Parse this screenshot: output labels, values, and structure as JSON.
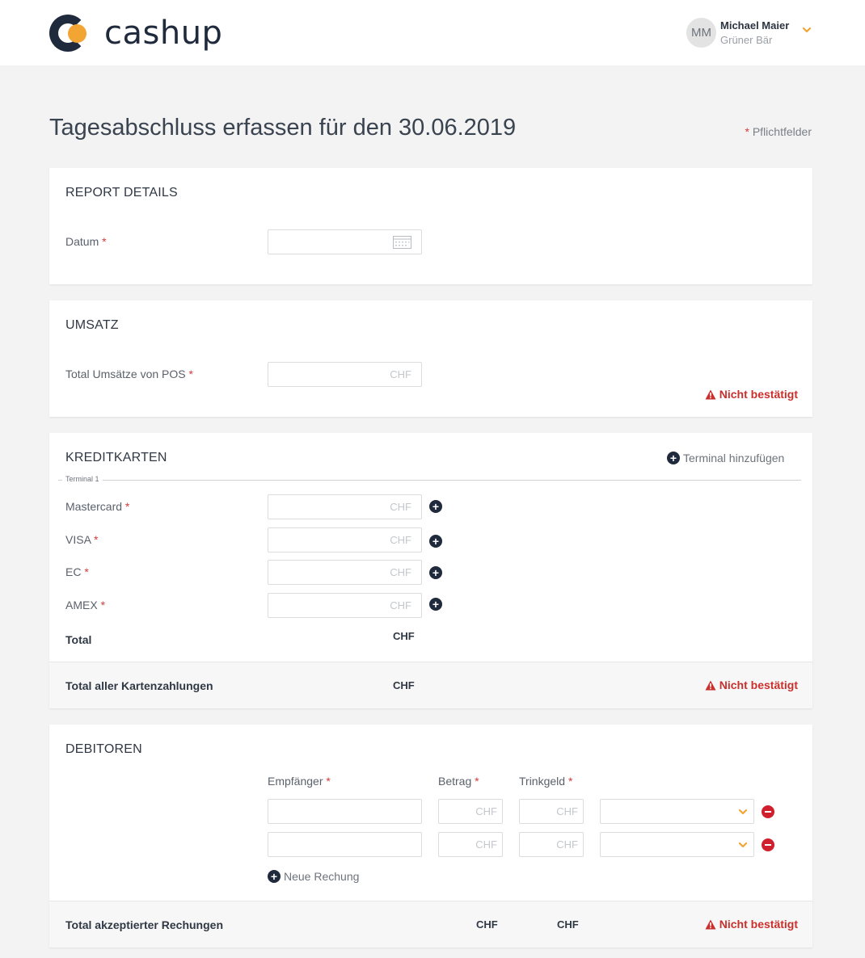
{
  "brand": {
    "name": "cashup",
    "accent": "#f3a533",
    "dark": "#1f2a3c",
    "danger": "#c9302c"
  },
  "user": {
    "initials": "MM",
    "name": "Michael Maier",
    "subtitle": "Grüner Bär"
  },
  "page": {
    "title": "Tagesabschluss erfassen für den 30.06.2019",
    "required_note": "Pflichtfelder",
    "required_mark": "*"
  },
  "report_details": {
    "title": "REPORT DETAILS",
    "date_label": "Datum"
  },
  "umsatz": {
    "title": "UMSATZ",
    "pos_label": "Total Umsätze von POS",
    "pos_placeholder": "CHF",
    "status": "Nicht bestätigt"
  },
  "kreditkarten": {
    "title": "KREDITKARTEN",
    "add_terminal": "Terminal hinzufügen",
    "terminal_label": "Terminal 1",
    "cards": [
      {
        "label": "Mastercard",
        "placeholder": "CHF"
      },
      {
        "label": "VISA",
        "placeholder": "CHF"
      },
      {
        "label": "EC",
        "placeholder": "CHF"
      },
      {
        "label": "AMEX",
        "placeholder": "CHF"
      }
    ],
    "total_label": "Total",
    "total_value": "CHF",
    "all_total_label": "Total aller Kartenzahlungen",
    "all_total_value": "CHF",
    "status": "Nicht bestätigt"
  },
  "debitoren": {
    "title": "DEBITOREN",
    "col_recipient": "Empfänger",
    "col_amount": "Betrag",
    "col_tip": "Trinkgeld",
    "rows": [
      {
        "amount_placeholder": "CHF",
        "tip_placeholder": "CHF"
      },
      {
        "amount_placeholder": "CHF",
        "tip_placeholder": "CHF"
      }
    ],
    "add_invoice": "Neue Rechung",
    "total_label": "Total akzeptierter Rechungen",
    "total_amount": "CHF",
    "total_tip": "CHF",
    "status": "Nicht bestätigt"
  }
}
